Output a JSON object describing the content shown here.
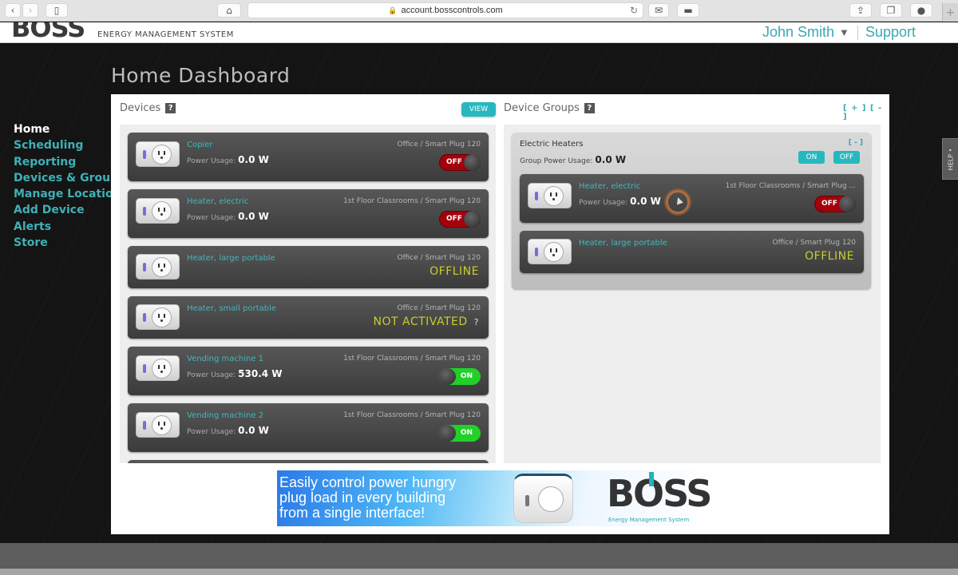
{
  "browser": {
    "url": "account.bosscontrols.com",
    "icons": [
      "back-icon",
      "forward-icon",
      "sidebar-icon",
      "home-icon",
      "lock-icon",
      "reload-icon",
      "mail-icon",
      "print-icon",
      "share-icon",
      "tabs-icon",
      "download-icon",
      "new-tab-icon"
    ]
  },
  "header": {
    "logo": "BOSS",
    "logo_subtitle": "ENERGY MANAGEMENT SYSTEM",
    "user_name": "John Smith",
    "user_caret": "▼",
    "support_label": "Support"
  },
  "page": {
    "title": "Home Dashboard"
  },
  "nav": {
    "items": [
      {
        "label": "Home",
        "active": true
      },
      {
        "label": "Scheduling"
      },
      {
        "label": "Reporting"
      },
      {
        "label": "Devices & Groups"
      },
      {
        "label": "Manage Locations"
      },
      {
        "label": "Add Device"
      },
      {
        "label": "Alerts"
      },
      {
        "label": "Store"
      }
    ]
  },
  "help_tab": "HELP •",
  "devices": {
    "title": "Devices",
    "help_badge": "?",
    "view_label": "VIEW",
    "power_label": "Power Usage:",
    "items": [
      {
        "name": "Copier",
        "location": "Office / Smart Plug 120",
        "power": "0.0 W",
        "state": "OFF"
      },
      {
        "name": "Heater, electric",
        "location": "1st Floor Classrooms / Smart Plug 120",
        "power": "0.0 W",
        "state": "OFF"
      },
      {
        "name": "Heater, large portable",
        "location": "Office / Smart Plug 120",
        "status": "OFFLINE"
      },
      {
        "name": "Heater, small portable",
        "location": "Office / Smart Plug 120",
        "status": "NOT ACTIVATED",
        "status_help": "?"
      },
      {
        "name": "Vending machine 1",
        "location": "1st Floor Classrooms / Smart Plug 120",
        "power": "530.4 W",
        "state": "ON"
      },
      {
        "name": "Vending machine 2",
        "location": "1st Floor Classrooms / Smart Plug 120",
        "power": "0.0 W",
        "state": "ON"
      }
    ]
  },
  "groups": {
    "title": "Device Groups",
    "help_badge": "?",
    "expand_collapse": "[ + ] [ - ]",
    "items": [
      {
        "name": "Electric Heaters",
        "power_label": "Group Power Usage:",
        "power": "0.0 W",
        "collapse": "[ - ]",
        "on_label": "ON",
        "off_label": "OFF",
        "devices": [
          {
            "name": "Heater, electric",
            "location": "1st Floor Classrooms / Smart Plug ...",
            "power": "0.0 W",
            "state": "OFF"
          },
          {
            "name": "Heater, large portable",
            "location": "Office / Smart Plug 120",
            "status": "OFFLINE"
          }
        ]
      }
    ]
  },
  "banner": {
    "line1": "Easily control power hungry",
    "line2": "plug load in every building",
    "line3": "from a single interface!",
    "logo": "BOSS",
    "logo_subtitle": "Energy Management System"
  },
  "colors": {
    "accent": "#3fb0b6",
    "toggle_off": "#a4000c",
    "toggle_on": "#22d02a",
    "status_warning": "#c8cc2e"
  }
}
